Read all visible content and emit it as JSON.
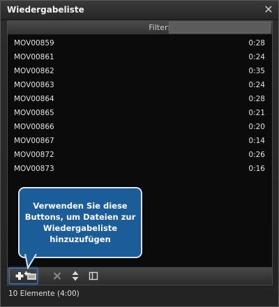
{
  "window": {
    "title": "Wiedergabeliste",
    "close_icon": "close-icon"
  },
  "filter": {
    "label": "Filter:",
    "value": ""
  },
  "playlist": [
    {
      "name": "MOV00859",
      "duration": "0:28"
    },
    {
      "name": "MOV00861",
      "duration": "0:24"
    },
    {
      "name": "MOV00862",
      "duration": "0:35"
    },
    {
      "name": "MOV00863",
      "duration": "0:24"
    },
    {
      "name": "MOV00864",
      "duration": "0:28"
    },
    {
      "name": "MOV00865",
      "duration": "0:21"
    },
    {
      "name": "MOV00866",
      "duration": "0:20"
    },
    {
      "name": "MOV00867",
      "duration": "0:14"
    },
    {
      "name": "MOV00872",
      "duration": "0:26"
    },
    {
      "name": "MOV00873",
      "duration": "0:16"
    }
  ],
  "toolbar": {
    "buttons": [
      "add-icon",
      "add-folder-icon",
      "remove-icon",
      "sort-icon",
      "view-panel-icon"
    ]
  },
  "tooltip": {
    "text": "Verwenden Sie diese Buttons, um Dateien zur Wiedergabeliste hinzuzufügen"
  },
  "status": {
    "text": "10 Elemente (4:00)"
  },
  "colors": {
    "tooltip_bg": "#1b5d99",
    "highlight": "#2e7ad0",
    "list_bg": "#0b0b0b"
  }
}
